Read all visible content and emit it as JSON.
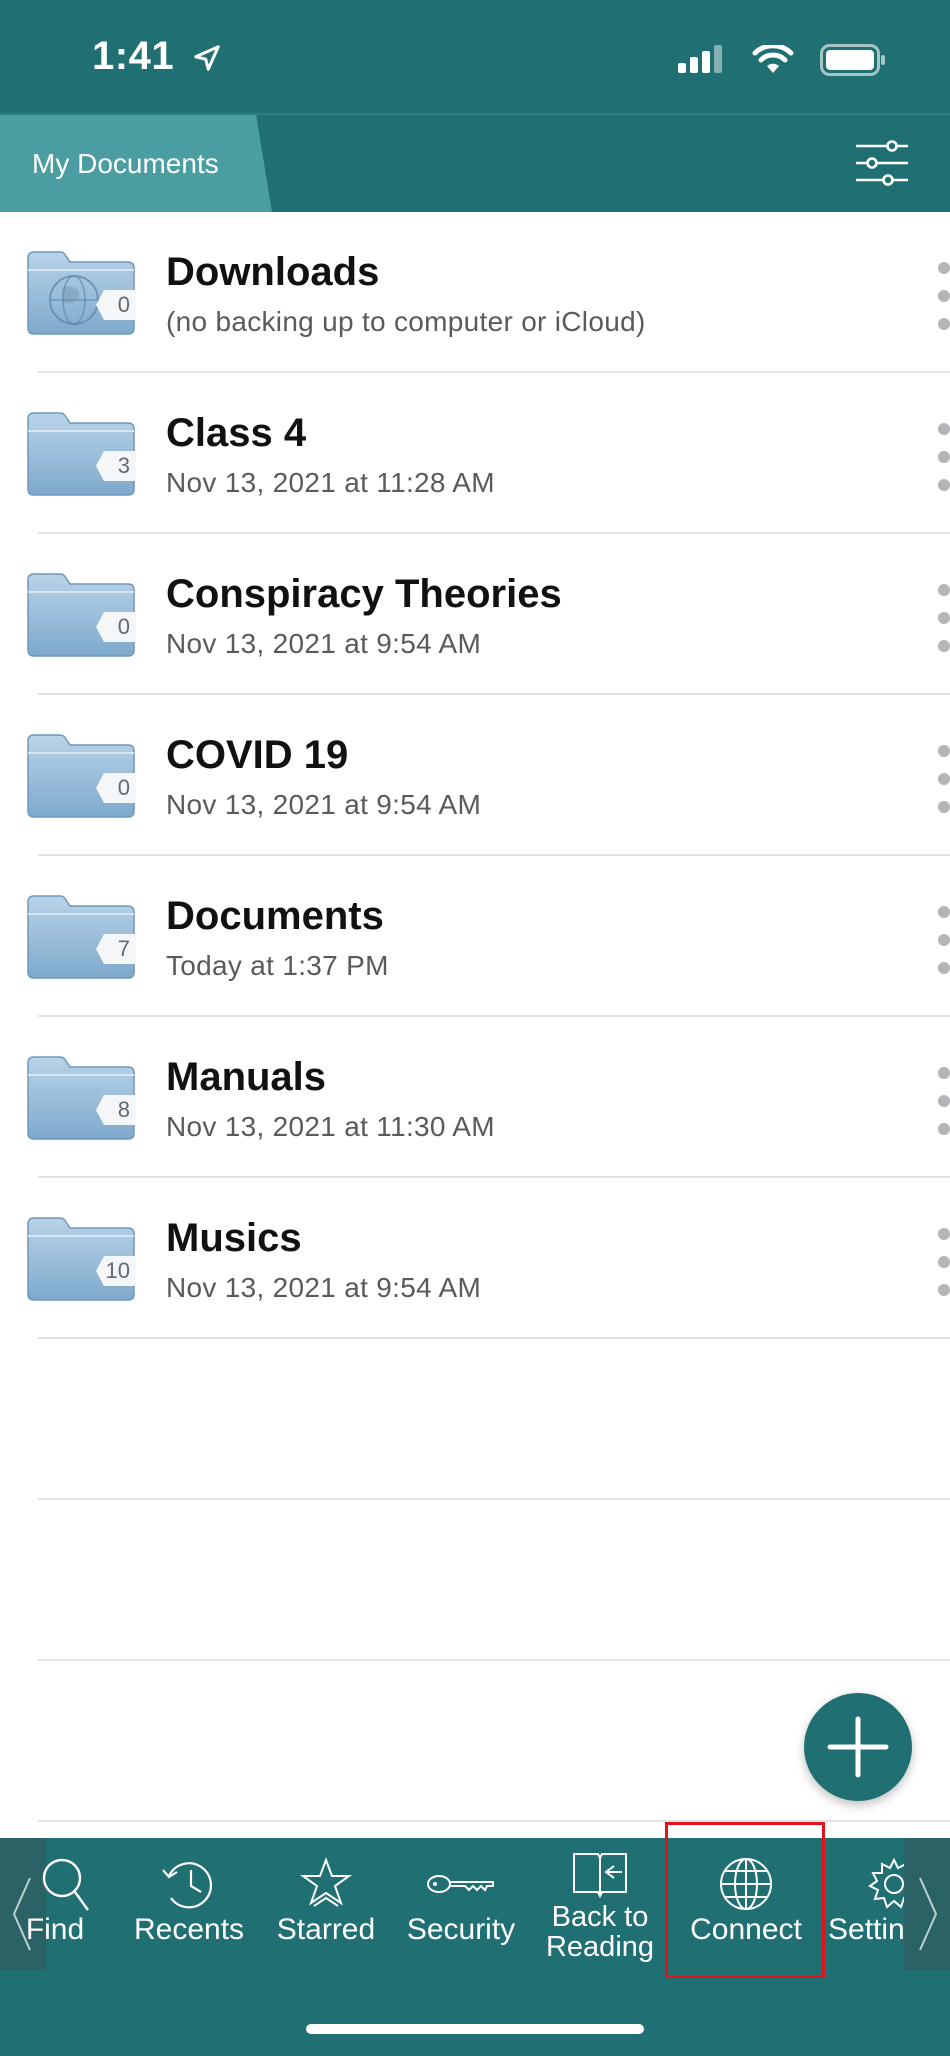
{
  "status_bar": {
    "time": "1:41"
  },
  "nav": {
    "title": "My Documents"
  },
  "folders": [
    {
      "name": "Downloads",
      "subtitle": "(no backing up to computer or iCloud)",
      "count": "0",
      "icon": "globe-folder-icon"
    },
    {
      "name": "Class 4",
      "subtitle": "Nov 13, 2021 at 11:28 AM",
      "count": "3",
      "icon": "folder-icon"
    },
    {
      "name": "Conspiracy Theories",
      "subtitle": "Nov 13, 2021 at 9:54 AM",
      "count": "0",
      "icon": "folder-icon"
    },
    {
      "name": "COVID 19",
      "subtitle": "Nov 13, 2021 at 9:54 AM",
      "count": "0",
      "icon": "folder-icon"
    },
    {
      "name": "Documents",
      "subtitle": "Today at 1:37 PM",
      "count": "7",
      "icon": "folder-icon"
    },
    {
      "name": "Manuals",
      "subtitle": "Nov 13, 2021 at 11:30 AM",
      "count": "8",
      "icon": "folder-icon"
    },
    {
      "name": "Musics",
      "subtitle": "Nov 13, 2021 at 9:54 AM",
      "count": "10",
      "icon": "folder-icon"
    }
  ],
  "tabs": [
    {
      "label": "Find",
      "icon": "search-icon"
    },
    {
      "label": "Recents",
      "icon": "clock-icon"
    },
    {
      "label": "Starred",
      "icon": "star-icon"
    },
    {
      "label": "Security",
      "icon": "key-icon"
    },
    {
      "label": "Back to Reading",
      "line1": "Back to",
      "line2": "Reading",
      "icon": "book-icon"
    },
    {
      "label": "Connect",
      "icon": "globe-icon"
    },
    {
      "label": "Settings",
      "icon": "gear-icon"
    }
  ],
  "colors": {
    "accent": "#1f6f73",
    "tab_highlight": "#4a9ea2",
    "selection_box": "#e0141a"
  }
}
